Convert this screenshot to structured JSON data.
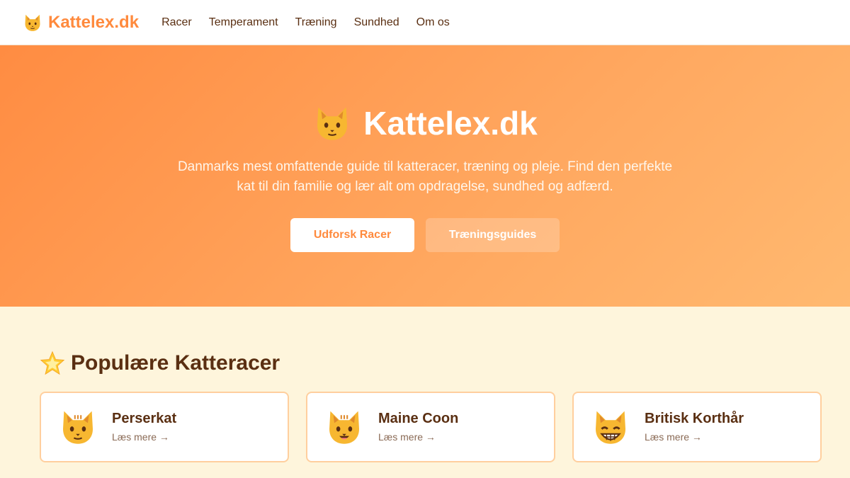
{
  "brand": {
    "name": "Kattelex.dk",
    "icon": "cat-face-icon",
    "color": "#ff8a3d"
  },
  "nav": [
    {
      "label": "Racer"
    },
    {
      "label": "Temperament"
    },
    {
      "label": "Træning"
    },
    {
      "label": "Sundhed"
    },
    {
      "label": "Om os"
    }
  ],
  "hero": {
    "title": "Kattelex.dk",
    "description": "Danmarks mest omfattende guide til katteracer, træning og pleje. Find den perfekte kat til din familie og lær alt om opdragelse, sundhed og adfærd.",
    "primary_button": "Udforsk Racer",
    "secondary_button": "Træningsguides"
  },
  "popular": {
    "title": "Populære Katteracer",
    "icon": "star-icon",
    "cards": [
      {
        "name": "Perserkat",
        "link": "Læs mere →",
        "icon": "cat-face-icon"
      },
      {
        "name": "Maine Coon",
        "link": "Læs mere →",
        "icon": "smiling-cat-icon"
      },
      {
        "name": "Britisk Korthår",
        "link": "Læs mere →",
        "icon": "grinning-cat-icon"
      }
    ]
  },
  "colors": {
    "accent": "#ff8a3d",
    "text": "#5a2f12",
    "background": "#fef5dc"
  }
}
